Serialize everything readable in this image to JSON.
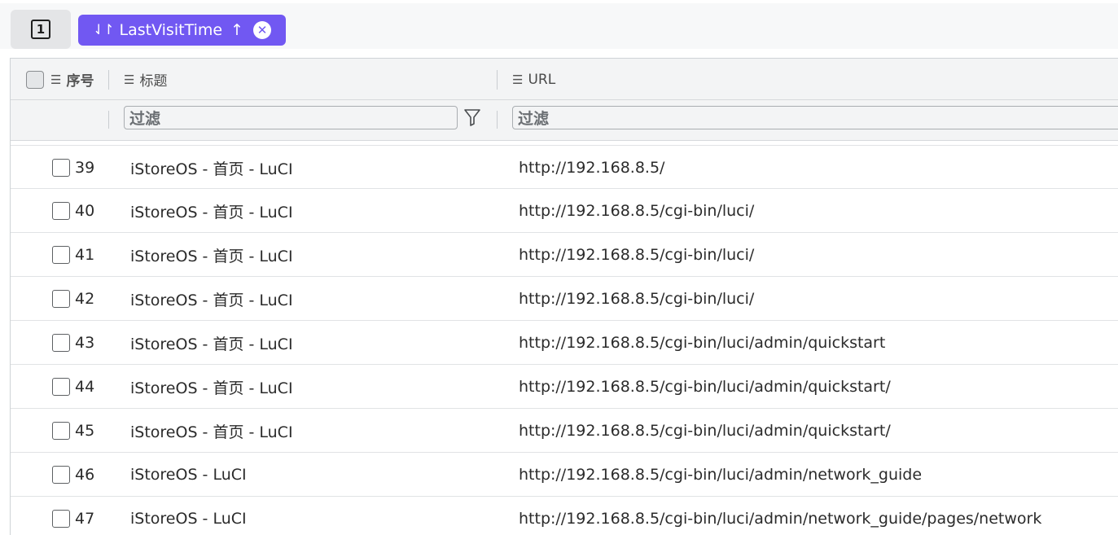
{
  "toolbar": {
    "counter_label": "1",
    "sort_chip": {
      "field": "LastVisitTime",
      "direction_glyph": "↑",
      "sort_glyph": "⇃↾",
      "remove_glyph": "✕",
      "color": "#7158f2"
    }
  },
  "columns": {
    "index": {
      "label": "序号",
      "icon": "list-icon"
    },
    "title": {
      "label": "标题",
      "icon": "list-icon",
      "filter_placeholder": "过滤"
    },
    "url": {
      "label": "URL",
      "icon": "list-icon",
      "filter_placeholder": "过滤"
    }
  },
  "rows": [
    {
      "index": "39",
      "title": "iStoreOS - 首页 - LuCI",
      "url": "http://192.168.8.5/"
    },
    {
      "index": "40",
      "title": "iStoreOS - 首页 - LuCI",
      "url": "http://192.168.8.5/cgi-bin/luci/"
    },
    {
      "index": "41",
      "title": "iStoreOS - 首页 - LuCI",
      "url": "http://192.168.8.5/cgi-bin/luci/"
    },
    {
      "index": "42",
      "title": "iStoreOS - 首页 - LuCI",
      "url": "http://192.168.8.5/cgi-bin/luci/"
    },
    {
      "index": "43",
      "title": "iStoreOS - 首页 - LuCI",
      "url": "http://192.168.8.5/cgi-bin/luci/admin/quickstart"
    },
    {
      "index": "44",
      "title": "iStoreOS - 首页 - LuCI",
      "url": "http://192.168.8.5/cgi-bin/luci/admin/quickstart/"
    },
    {
      "index": "45",
      "title": "iStoreOS - 首页 - LuCI",
      "url": "http://192.168.8.5/cgi-bin/luci/admin/quickstart/"
    },
    {
      "index": "46",
      "title": "iStoreOS - LuCI",
      "url": "http://192.168.8.5/cgi-bin/luci/admin/network_guide"
    },
    {
      "index": "47",
      "title": "iStoreOS - LuCI",
      "url": "http://192.168.8.5/cgi-bin/luci/admin/network_guide/pages/network"
    }
  ]
}
